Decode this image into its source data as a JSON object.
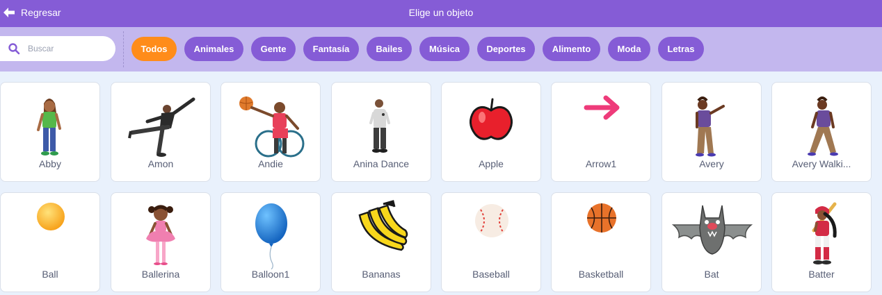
{
  "header": {
    "back_label": "Regresar",
    "title": "Elige un objeto"
  },
  "search": {
    "placeholder": "Buscar",
    "value": ""
  },
  "tags": [
    {
      "label": "Todos",
      "active": true
    },
    {
      "label": "Animales",
      "active": false
    },
    {
      "label": "Gente",
      "active": false
    },
    {
      "label": "Fantasía",
      "active": false
    },
    {
      "label": "Bailes",
      "active": false
    },
    {
      "label": "Música",
      "active": false
    },
    {
      "label": "Deportes",
      "active": false
    },
    {
      "label": "Alimento",
      "active": false
    },
    {
      "label": "Moda",
      "active": false
    },
    {
      "label": "Letras",
      "active": false
    }
  ],
  "sprites": [
    {
      "label": "Abby",
      "icon": "abby-icon"
    },
    {
      "label": "Amon",
      "icon": "amon-icon"
    },
    {
      "label": "Andie",
      "icon": "andie-icon"
    },
    {
      "label": "Anina Dance",
      "icon": "anina-dance-icon"
    },
    {
      "label": "Apple",
      "icon": "apple-icon"
    },
    {
      "label": "Arrow1",
      "icon": "arrow1-icon"
    },
    {
      "label": "Avery",
      "icon": "avery-icon"
    },
    {
      "label": "Avery Walki...",
      "icon": "avery-walking-icon"
    },
    {
      "label": "Ball",
      "icon": "ball-icon"
    },
    {
      "label": "Ballerina",
      "icon": "ballerina-icon"
    },
    {
      "label": "Balloon1",
      "icon": "balloon1-icon"
    },
    {
      "label": "Bananas",
      "icon": "bananas-icon"
    },
    {
      "label": "Baseball",
      "icon": "baseball-icon"
    },
    {
      "label": "Basketball",
      "icon": "basketball-icon"
    },
    {
      "label": "Bat",
      "icon": "bat-icon"
    },
    {
      "label": "Batter",
      "icon": "batter-icon"
    }
  ],
  "colors": {
    "header": "#855cd6",
    "filter_bar": "#c3b7ee",
    "active_tag": "#ff8c1a",
    "tag": "#855cd6",
    "background": "#e9f1fc"
  }
}
